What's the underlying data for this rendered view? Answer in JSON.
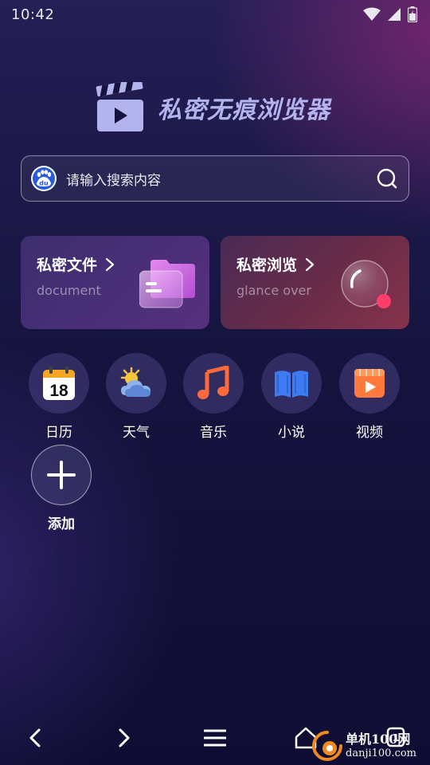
{
  "status_bar": {
    "time": "10:42",
    "icons": [
      "wifi-icon",
      "signal-icon",
      "battery-icon"
    ]
  },
  "header": {
    "app_title": "私密无痕浏览器",
    "logo_icon": "clapperboard-play-icon"
  },
  "search": {
    "placeholder": "请输入搜索内容",
    "engine_icon": "baidu-paw-icon",
    "engine_text": "du"
  },
  "cards": [
    {
      "title": "私密文件",
      "subtitle": "document",
      "icon": "folder-icon",
      "arrow_icon": "chevron-right-icon"
    },
    {
      "title": "私密浏览",
      "subtitle": "glance over",
      "icon": "glass-sphere-icon",
      "arrow_icon": "chevron-right-icon"
    }
  ],
  "apps": [
    {
      "label": "日历",
      "icon": "calendar-icon",
      "icon_text": "18"
    },
    {
      "label": "天气",
      "icon": "weather-icon"
    },
    {
      "label": "音乐",
      "icon": "music-note-icon"
    },
    {
      "label": "小说",
      "icon": "book-icon"
    },
    {
      "label": "视频",
      "icon": "video-play-icon"
    },
    {
      "label": "添加",
      "icon": "plus-icon"
    }
  ],
  "bottom_nav": {
    "items": [
      "back-icon",
      "forward-icon",
      "menu-icon",
      "home-icon",
      "tabs-icon"
    ],
    "tab_count": "1"
  },
  "watermark": {
    "line1": "单机100网",
    "line2": "danji100.com"
  },
  "colors": {
    "background": "#16143f",
    "accent_purple": "#b3b3ee",
    "card_files": "#4b2f78",
    "card_browse": "#6a2c48",
    "folder": "#d86ee6",
    "sphere_dot": "#ff3d6a"
  }
}
